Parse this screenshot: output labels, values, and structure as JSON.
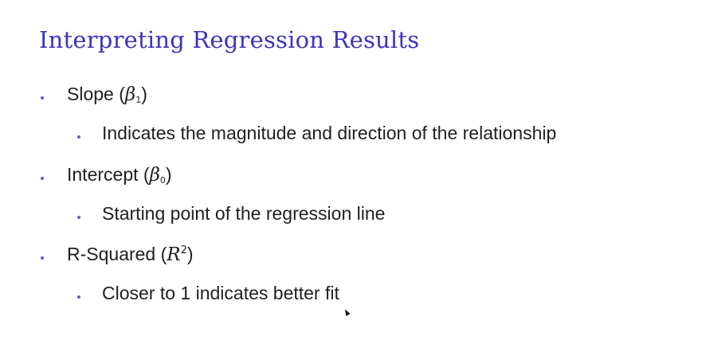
{
  "slide": {
    "title": "Interpreting Regression Results",
    "accent_color": "#3b35b8",
    "bullet_color": "#5a5fc4",
    "items": [
      {
        "label": "Slope",
        "symbol": "β",
        "subscript": "1",
        "sub_items": [
          "Indicates the magnitude and direction of the relationship"
        ]
      },
      {
        "label": "Intercept",
        "symbol": "β",
        "subscript": "0",
        "sub_items": [
          "Starting point of the regression line"
        ]
      },
      {
        "label": "R-Squared",
        "symbol": "R",
        "superscript": "2",
        "sub_items": [
          "Closer to 1 indicates better fit"
        ]
      }
    ]
  }
}
